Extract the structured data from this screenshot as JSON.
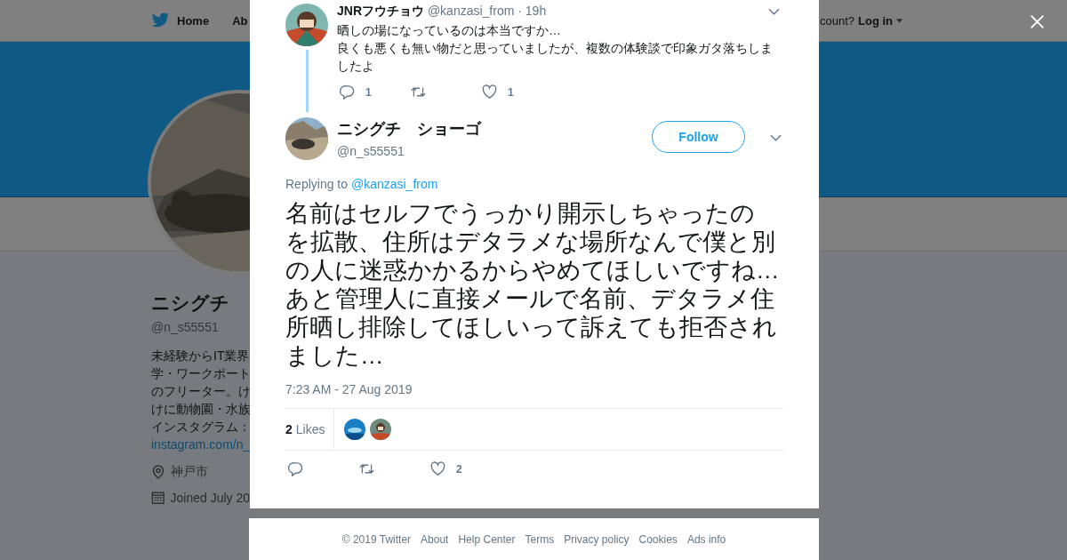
{
  "background": {
    "nav": {
      "items": [
        "Home",
        "Ab"
      ],
      "login_prompt": "count?",
      "login": "Log in"
    },
    "profile": {
      "name": "ニシグチ",
      "handle": "@n_s55551",
      "bio_lines": [
        "未経験からIT業界",
        "学・ワークポート",
        "のフリーター。け",
        "けに動物園・水族",
        "インスタグラム："
      ],
      "bio_link": "instagram.com/n_",
      "location": "神戸市",
      "joined": "Joined July 20"
    }
  },
  "modal": {
    "parent_tweet": {
      "name": "JNRフウチョウ",
      "handle": "@kanzasi_from",
      "time": "· 19h",
      "text": "晒しの場になっているのは本当ですか…\n良くも悪くも無い物だと思っていましたが、複数の体験談で印象ガタ落ちしましたよ",
      "replies": "1",
      "likes": "1"
    },
    "tweet": {
      "name": "ニシグチ　ショーゴ",
      "handle": "@n_s55551",
      "follow": "Follow",
      "replying_label": "Replying to",
      "replying_handle": "@kanzasi_from",
      "text_lines": [
        "名前はセルフでうっかり開示しちゃったの",
        "を拡散、住所はデタラメな場所なんで僕と別",
        "の人に迷惑かかるからやめてほしいですね…",
        "あと管理人に直接メールで名前、デタラメ住",
        "所晒し排除してほしいって訴えても拒否され",
        "ました…"
      ],
      "timestamp": "7:23 AM - 27 Aug 2019",
      "likes_count": "2",
      "likes_label": "Likes",
      "like_count": "2"
    },
    "footer": [
      "© 2019 Twitter",
      "About",
      "Help Center",
      "Terms",
      "Privacy policy",
      "Cookies",
      "Ads info"
    ]
  }
}
